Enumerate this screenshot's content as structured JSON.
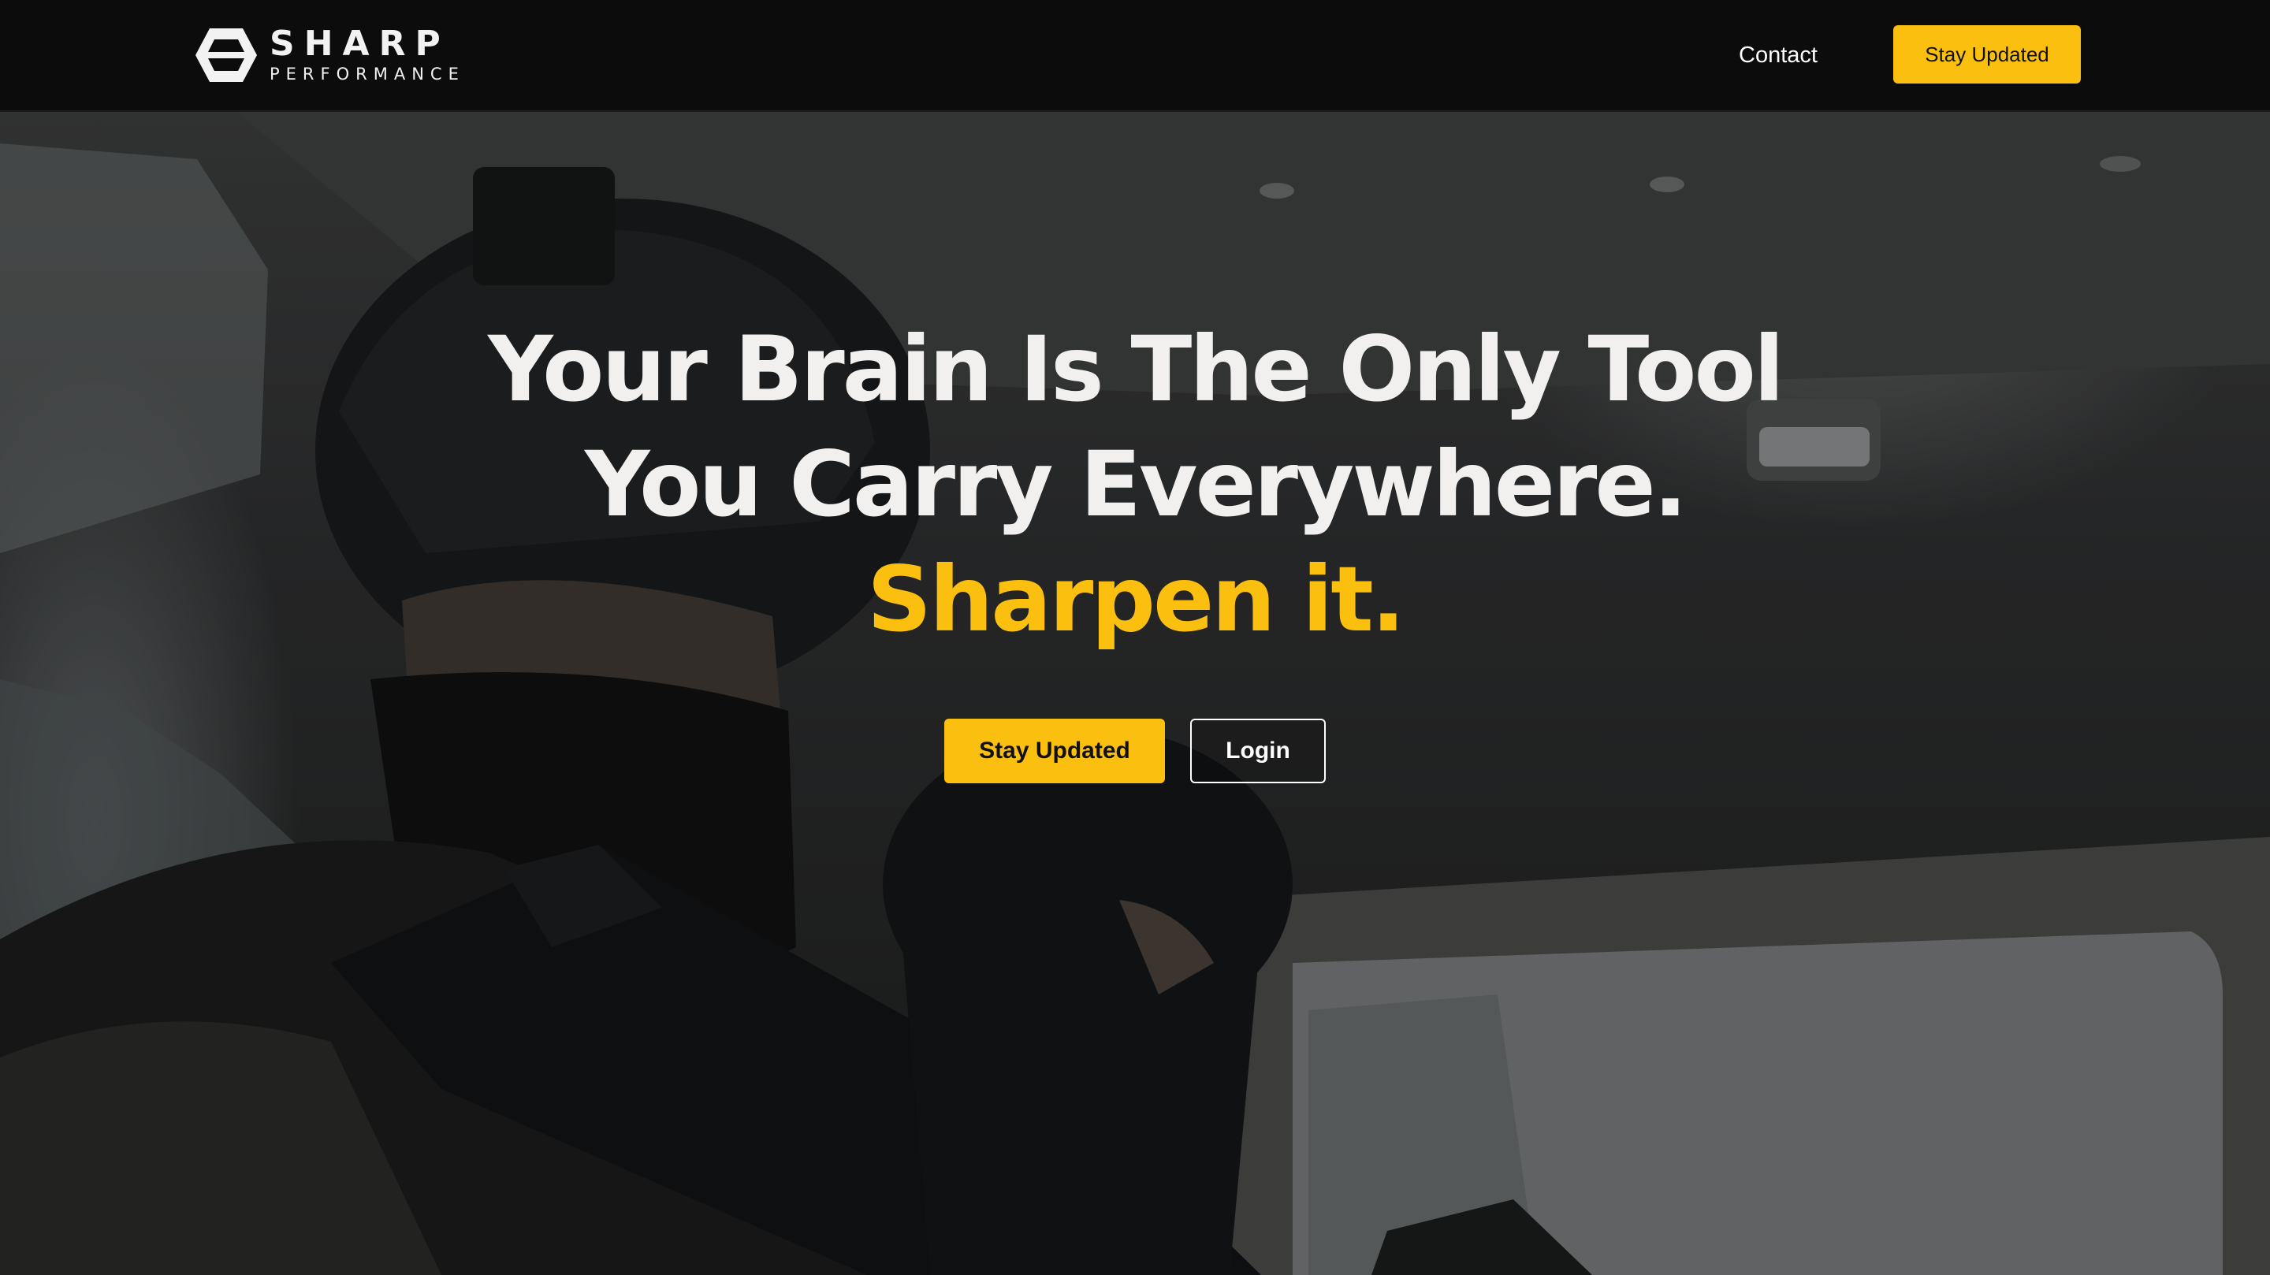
{
  "nav": {
    "logo_word": "SHARP",
    "logo_sub": "PERFORMANCE",
    "contact_label": "Contact",
    "cta_label": "Stay Updated"
  },
  "hero": {
    "headline_line1": "Your Brain Is The Only Tool",
    "headline_line2": "You Carry Everywhere.",
    "headline_accent": "Sharpen it.",
    "primary_cta": "Stay Updated",
    "secondary_cta": "Login",
    "background_image": "soldiers-in-vehicle-photo"
  },
  "colors": {
    "accent": "#fbbf0f",
    "nav_background": "#0c0c0c",
    "headline_text": "#f1f0ef"
  },
  "icons": {
    "logo_mark": "hexagon-logo-icon"
  }
}
